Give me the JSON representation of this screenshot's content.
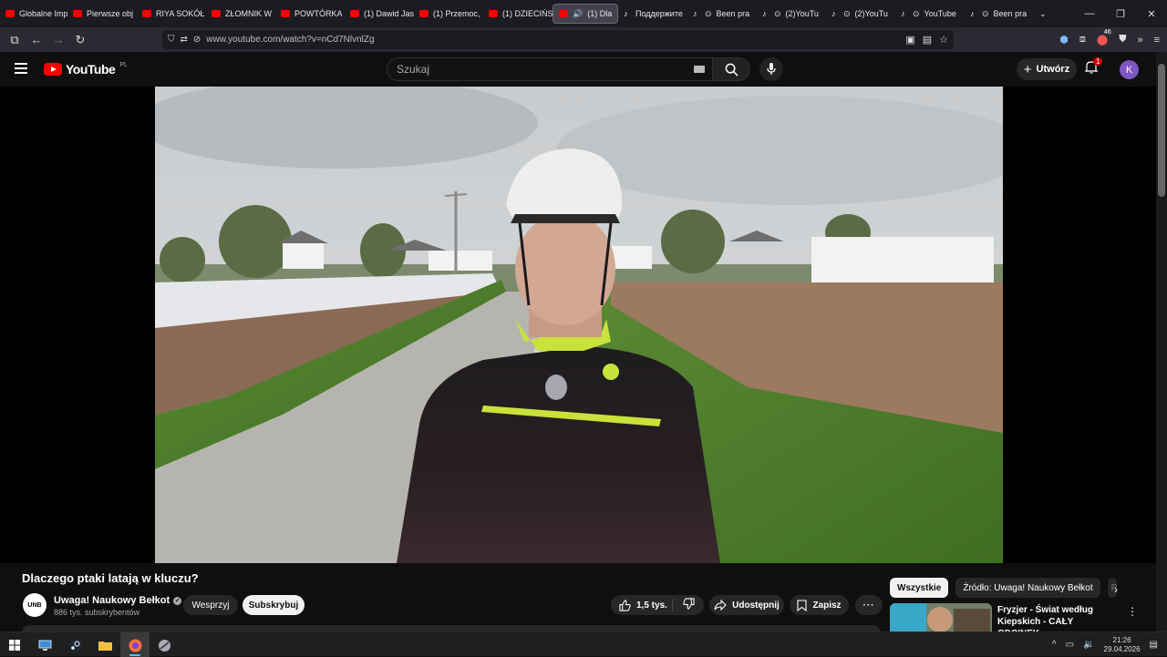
{
  "browser": {
    "tabs": [
      {
        "label": "Globalne Imp",
        "icon": "youtube"
      },
      {
        "label": "Pierwsze obj",
        "icon": "youtube"
      },
      {
        "label": "RIYA SOKÓŁ",
        "icon": "youtube"
      },
      {
        "label": "ZŁOMNIK W",
        "icon": "youtube"
      },
      {
        "label": "POWTÓRKA",
        "icon": "youtube"
      },
      {
        "label": "(1) Dawid Jas",
        "icon": "youtube"
      },
      {
        "label": "(1) Przemoc,",
        "icon": "youtube"
      },
      {
        "label": "(1) DZIECIŃS",
        "icon": "youtube"
      },
      {
        "label": "(1) Dla",
        "icon": "youtube",
        "active": true
      },
      {
        "label": "Поддержите",
        "icon": "tiktok"
      },
      {
        "label": "Been pra",
        "icon": "tiktok"
      },
      {
        "label": "(2)YouTu",
        "icon": "tiktok"
      },
      {
        "label": "(2)YouTu",
        "icon": "tiktok"
      },
      {
        "label": "YouTube",
        "icon": "tiktok"
      },
      {
        "label": "Been pra",
        "icon": "tiktok"
      }
    ],
    "url": "www.youtube.com/watch?v=nCd7NlvnlZg",
    "extension_badge": "46"
  },
  "youtube": {
    "logo_text": "YouTube",
    "region": "PL",
    "search_placeholder": "Szukaj",
    "create_label": "Utwórz",
    "notifications": "1",
    "avatar_letter": "K"
  },
  "video": {
    "title": "Dlaczego ptaki latają w kluczu?",
    "channel_initials": "UNB",
    "channel_name": "Uwaga! Naukowy Bełkot",
    "subscribers": "886 tys. subskrybentów",
    "join_label": "Wesprzyj",
    "subscribe_label": "Subskrybuj",
    "likes": "1,5 tys.",
    "share_label": "Udostępnij",
    "save_label": "Zapisz"
  },
  "sidebar": {
    "chips": [
      "Wszystkie",
      "Źródło: Uwaga! Naukowy Bełkot",
      "P"
    ],
    "recommendation": {
      "title": "Fryzjer - Świat według Kiepskich - CAŁY ODCINEK ..."
    }
  },
  "taskbar": {
    "time": "21:26",
    "date": "29.04.2026"
  },
  "colors": {
    "youtube_red": "#ff0000",
    "background": "#0f0f0f",
    "avatar": "#7e57c2"
  }
}
